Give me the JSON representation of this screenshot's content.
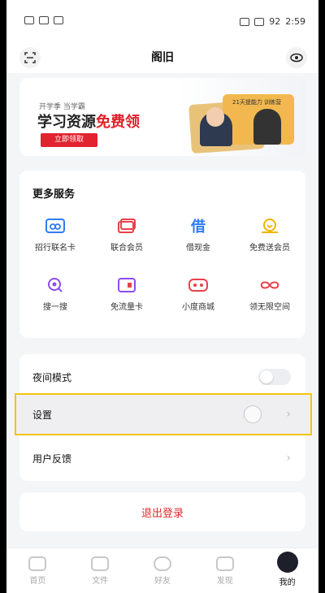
{
  "status": {
    "time": "2:59",
    "battery": "92"
  },
  "header": {
    "title": "阁旧"
  },
  "banner": {
    "small": "开学季 当学霸",
    "headline_a": "学习资源",
    "headline_b": "免费领",
    "button": "立即领取",
    "card_text": "21天提能力 训练营"
  },
  "services": {
    "title": "更多服务",
    "items": [
      {
        "label": "招行联名卡",
        "icon": "bank-card-icon",
        "color": "#2f7bf5"
      },
      {
        "label": "联合会员",
        "icon": "member-card-icon",
        "color": "#e8414c"
      },
      {
        "label": "借现金",
        "icon": "loan-icon",
        "color": "#2f7bf5"
      },
      {
        "label": "免费送会员",
        "icon": "gift-member-icon",
        "color": "#f0b400"
      },
      {
        "label": "搜一搜",
        "icon": "search-icon",
        "color": "#8a4df0"
      },
      {
        "label": "免流量卡",
        "icon": "sim-card-icon",
        "color": "#8a4df0"
      },
      {
        "label": "小度商城",
        "icon": "robot-icon",
        "color": "#e8414c"
      },
      {
        "label": "领无限空间",
        "icon": "infinity-icon",
        "color": "#e8414c"
      }
    ]
  },
  "settings": {
    "night_mode": "夜间模式",
    "settings": "设置",
    "feedback": "用户反馈"
  },
  "logout": "退出登录",
  "tabs": [
    {
      "label": "首页",
      "icon": "cloud-icon"
    },
    {
      "label": "文件",
      "icon": "folder-icon"
    },
    {
      "label": "好友",
      "icon": "friends-icon"
    },
    {
      "label": "发现",
      "icon": "discover-icon"
    },
    {
      "label": "我的",
      "icon": "profile-icon"
    }
  ]
}
